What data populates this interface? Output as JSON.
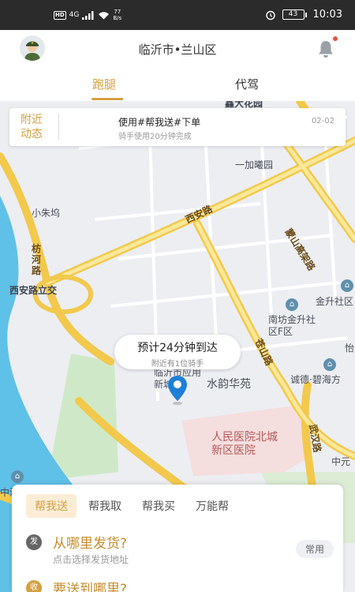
{
  "status_bar": {
    "hd": "HD",
    "net_speed": "77",
    "net_unit": "B/s",
    "signal": "4G",
    "battery": "43",
    "time": "10:03"
  },
  "header": {
    "city": "临沂市•兰山区"
  },
  "tabs": [
    {
      "label": "跑腿",
      "active": true
    },
    {
      "label": "代驾",
      "active": false
    }
  ],
  "news": {
    "tag": "附近动态",
    "title": "使用#帮我送#下单",
    "subtitle": "骑手使用20分钟完成",
    "date": "02-02"
  },
  "map": {
    "labels": {
      "top_road": "鑫大花园",
      "yijia": "一加曦园",
      "mengshan": "蒙山高架路",
      "xiaozhu": "小朱坞",
      "xian_road": "西安路",
      "fanghe": "枋河路",
      "xian_interchange": "西安路立交",
      "jinsheng": "金升社区",
      "nanfang": "南坊金升社区F区",
      "cangshan": "苍山路",
      "yi": "怡",
      "chengde": "诚德·碧海方",
      "linyi_zone": "临沂市应用新城",
      "shuiyun": "水韵华苑",
      "hospital": "人民医院北城新区医院",
      "wuhan": "武汉路",
      "zhongyuan": "中元",
      "zhonghe": "中河"
    }
  },
  "eta": {
    "main": "预计24分钟到达",
    "sub": "附近有1位骑手"
  },
  "services": [
    {
      "label": "帮我送",
      "active": true
    },
    {
      "label": "帮我取",
      "active": false
    },
    {
      "label": "帮我买",
      "active": false
    },
    {
      "label": "万能帮",
      "active": false
    }
  ],
  "from": {
    "badge": "发",
    "title": "从哪里发货?",
    "subtitle": "点击选择发货地址",
    "common": "常用"
  },
  "to": {
    "badge": "收",
    "title": "要送到哪里?"
  },
  "colors": {
    "accent": "#d4a041",
    "road_yellow": "#f7d764",
    "river": "#5fc0e8",
    "park": "#cfe9c8"
  }
}
